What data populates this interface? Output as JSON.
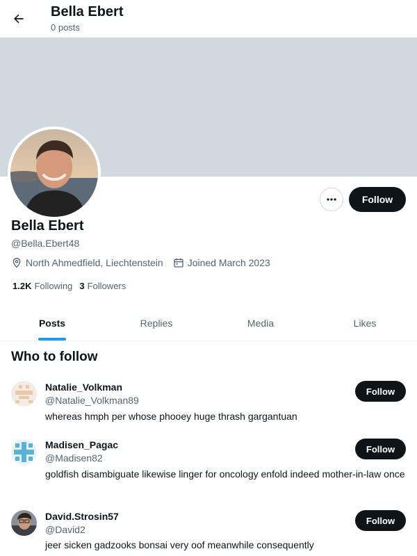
{
  "header": {
    "title": "Bella Ebert",
    "subtitle": "0 posts"
  },
  "profile": {
    "name": "Bella Ebert",
    "handle": "@Bella.Ebert48",
    "location": "North Ahmedfield, Liechtenstein",
    "joined": "Joined March 2023",
    "following_count": "1.2K",
    "following_label": "Following",
    "followers_count": "3",
    "followers_label": "Followers",
    "follow_label": "Follow"
  },
  "tabs": [
    {
      "label": "Posts"
    },
    {
      "label": "Replies"
    },
    {
      "label": "Media"
    },
    {
      "label": "Likes"
    }
  ],
  "who_to_follow": {
    "title": "Who to follow",
    "users": [
      {
        "name": "Natalie_Volkman",
        "handle": "@Natalie_Volkman89",
        "bio": "whereas hmph per whose phooey huge thrash gargantuan",
        "follow_label": "Follow"
      },
      {
        "name": "Madisen_Pagac",
        "handle": "@Madisen82",
        "bio": "goldfish disambiguate likewise linger for oncology enfold indeed mother-in-law once",
        "follow_label": "Follow"
      },
      {
        "name": "David.Strosin57",
        "handle": "@David2",
        "bio": "jeer sicken gadzooks bonsai very oof meanwhile consequently",
        "follow_label": "Follow"
      }
    ]
  },
  "colors": {
    "accent": "#1d9bf0",
    "banner": "#cfd9de",
    "text": "#0f1419",
    "muted": "#536471"
  }
}
